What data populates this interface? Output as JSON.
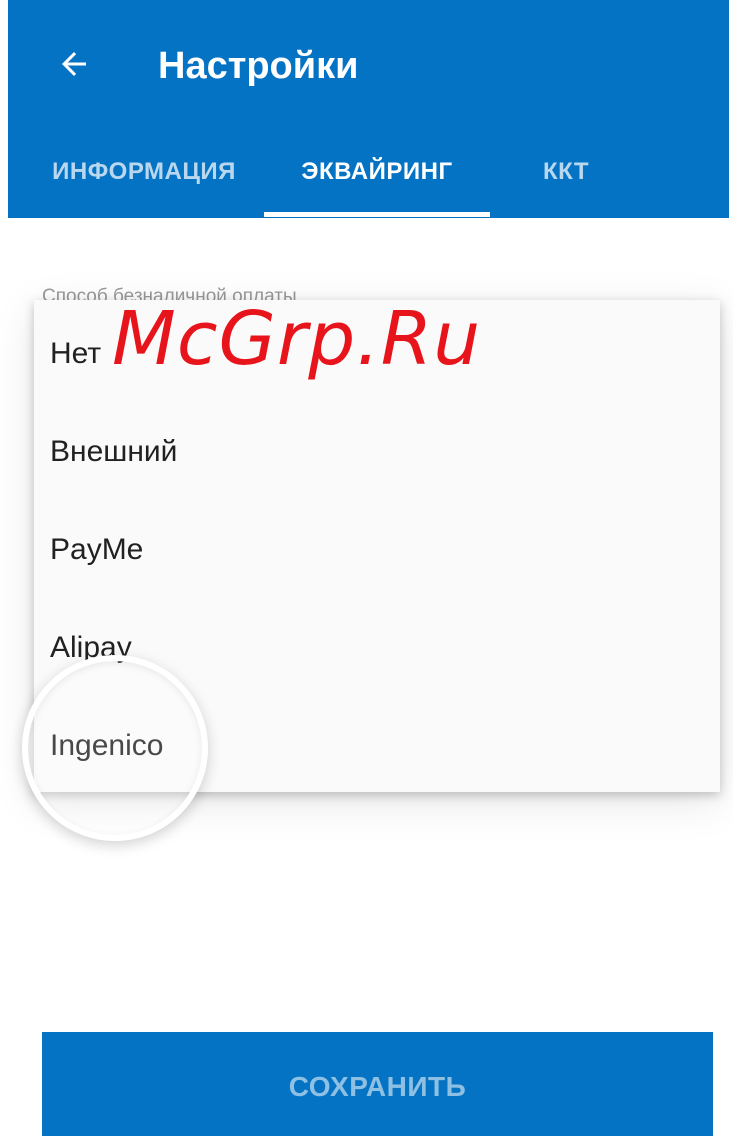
{
  "app_bar": {
    "title": "Настройки",
    "back_icon": "arrow-left-icon",
    "background_color": "#0573c4"
  },
  "tabs": [
    {
      "label": "ИНФОРМАЦИЯ",
      "active": false
    },
    {
      "label": "ЭКВАЙРИНГ",
      "active": true
    },
    {
      "label": "ККТ",
      "active": false
    }
  ],
  "payment_method": {
    "label": "Способ безналичной оплаты",
    "options": [
      "Нет",
      "Внешний",
      "PayMe",
      "Alipay",
      "Ingenico"
    ],
    "highlighted_option": "Ingenico"
  },
  "watermark": "McGrp.Ru",
  "save_button": {
    "label": "СОХРАНИТЬ"
  }
}
